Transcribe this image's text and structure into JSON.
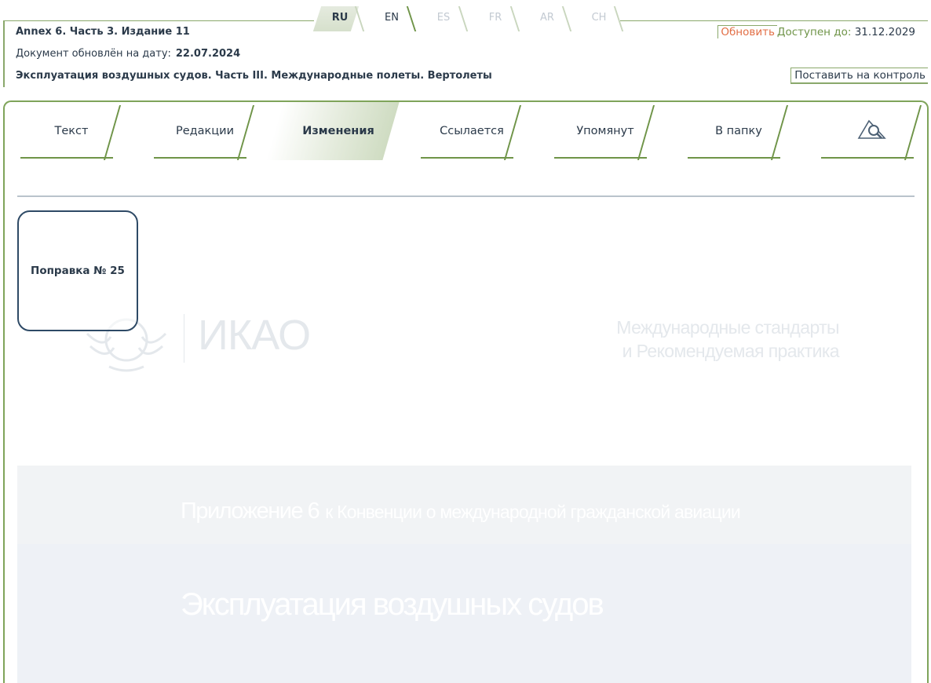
{
  "header": {
    "doc_title": "Annex 6. Часть 3. Издание 11",
    "updated_label": "Документ обновлён на дату:",
    "updated_date": "22.07.2024",
    "doc_name": "Эксплуатация воздушных судов. Часть III. Международные полеты. Вертолеты",
    "refresh_label": "Обновить",
    "available_label": "Доступен до:",
    "available_date": "31.12.2029",
    "monitor_label": "Поставить на контроль"
  },
  "languages": [
    {
      "code": "RU",
      "active": true
    },
    {
      "code": "EN",
      "active": false
    },
    {
      "code": "ES",
      "active": false
    },
    {
      "code": "FR",
      "active": false
    },
    {
      "code": "AR",
      "active": false
    },
    {
      "code": "CH",
      "active": false
    }
  ],
  "tabs": [
    {
      "label": "Текст"
    },
    {
      "label": "Редакции"
    },
    {
      "label": "Изменения",
      "active": true
    },
    {
      "label": "Ссылается"
    },
    {
      "label": "Упомянут"
    },
    {
      "label": "В папку"
    },
    {
      "icon": "search-icon"
    }
  ],
  "amendment": {
    "label": "Поправка № 25"
  },
  "document_bg": {
    "org": "ИКАО",
    "standards_line1": "Международные стандарты",
    "standards_line2": "и Рекомендуемая практика",
    "annex_big": "Приложение 6",
    "annex_small": "к Конвенции о международной гражданской авиации",
    "cover_title": "Эксплуатация воздушных судов"
  },
  "colors": {
    "accent_green": "#6f9448",
    "refresh_orange": "#e26e45",
    "text_dark": "#2b3a4a",
    "card_border": "#2e4a66"
  }
}
